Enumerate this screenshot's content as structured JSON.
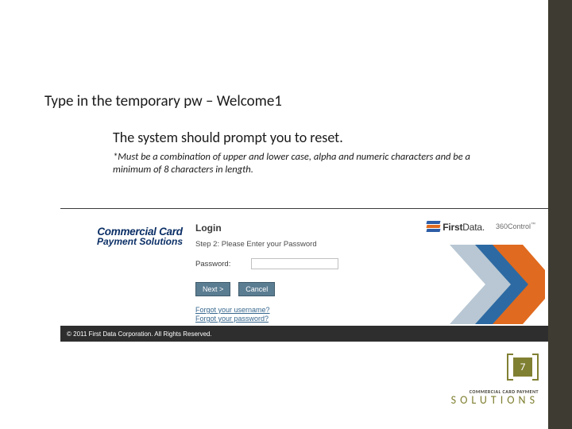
{
  "instruction": {
    "title": "Type in the temporary pw – Welcome1",
    "subtitle": "The system should prompt you to reset.",
    "note": "*Must be a combination of upper and lower case, alpha and numeric characters and be a minimum of 8 characters in length."
  },
  "shot": {
    "brand_left_line1": "Commercial Card",
    "brand_left_line2": "Payment Solutions",
    "login_heading": "Login",
    "step_text": "Step 2: Please Enter your Password",
    "password_label": "Password:",
    "password_value": "",
    "next_button": "Next >",
    "cancel_button": "Cancel",
    "link_forgot_user": "Forgot your username?",
    "link_forgot_pw": "Forgot your password?",
    "firstdata_text_bold": "First",
    "firstdata_text_rest": "Data.",
    "control360": "360Control",
    "footer": "© 2011 First Data Corporation. All Rights Reserved."
  },
  "page_number": "7",
  "footer_logo": {
    "line1": "COMMERCIAL CARD PAYMENT",
    "line2": "SOLUTIONS"
  }
}
